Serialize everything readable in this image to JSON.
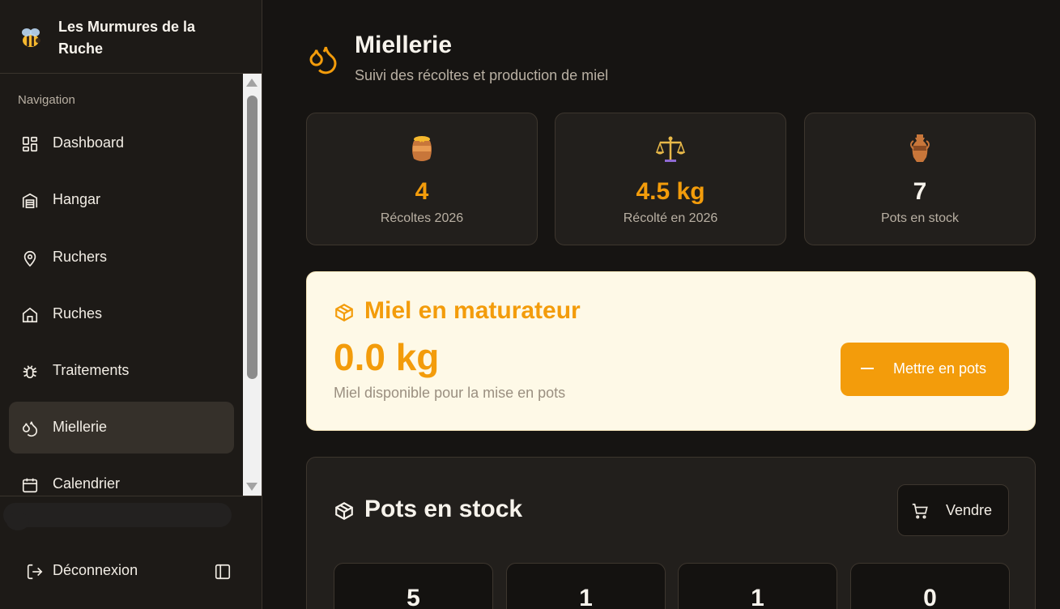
{
  "app": {
    "title": "Les Murmures de la Ruche",
    "logo": "bee-emoji"
  },
  "sidebar": {
    "group_label": "Navigation",
    "items": [
      {
        "label": "Dashboard",
        "icon": "dashboard-icon"
      },
      {
        "label": "Hangar",
        "icon": "warehouse-icon"
      },
      {
        "label": "Ruchers",
        "icon": "map-pin-icon"
      },
      {
        "label": "Ruches",
        "icon": "home-icon"
      },
      {
        "label": "Traitements",
        "icon": "bug-icon"
      },
      {
        "label": "Miellerie",
        "icon": "droplets-icon",
        "active": true
      },
      {
        "label": "Calendrier",
        "icon": "calendar-icon"
      }
    ],
    "logout_label": "Déconnexion"
  },
  "page": {
    "title": "Miellerie",
    "subtitle": "Suivi des récoltes et production de miel"
  },
  "stats": [
    {
      "icon": "honey-pot-emoji",
      "value": "4",
      "label": "Récoltes 2026",
      "color": "#f39c0b"
    },
    {
      "icon": "balance-scale-emoji",
      "value": "4.5 kg",
      "label": "Récolté en 2026",
      "color": "#f39c0b"
    },
    {
      "icon": "amphora-emoji",
      "value": "7",
      "label": "Pots en stock",
      "color": "#f7f3ec"
    }
  ],
  "maturator": {
    "title": "Miel en maturateur",
    "value": "0.0 kg",
    "description": "Miel disponible pour la mise en pots",
    "button_label": "Mettre en pots"
  },
  "stock": {
    "title": "Pots en stock",
    "sell_label": "Vendre",
    "pots": [
      "5",
      "1",
      "1",
      "0"
    ]
  },
  "colors": {
    "accent": "#f39c0b",
    "background": "#161412",
    "card": "#221f1c",
    "maturator_bg": "#fef9e7"
  }
}
